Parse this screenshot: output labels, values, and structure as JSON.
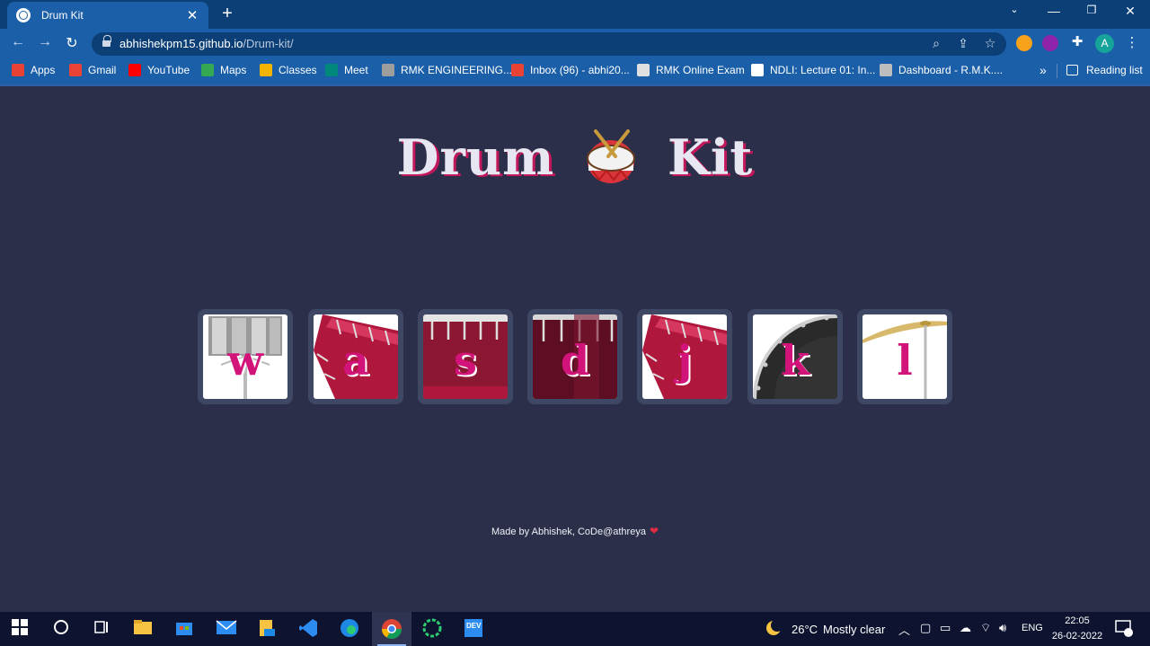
{
  "browser": {
    "tab_title": "Drum Kit",
    "url_host": "abhishekpm15.github.io",
    "url_path": "/Drum-kit/",
    "reading_list": "Reading list",
    "avatar_letter": "A",
    "bookmarks": [
      {
        "label": "Apps",
        "icon": "apps-grid-icon",
        "color": "#e94235"
      },
      {
        "label": "Gmail",
        "icon": "gmail-icon",
        "color": "#ea4335"
      },
      {
        "label": "YouTube",
        "icon": "youtube-icon",
        "color": "#ff0000"
      },
      {
        "label": "Maps",
        "icon": "maps-icon",
        "color": "#34a853"
      },
      {
        "label": "Classes",
        "icon": "classroom-icon",
        "color": "#f4b400"
      },
      {
        "label": "Meet",
        "icon": "meet-icon",
        "color": "#00897b"
      },
      {
        "label": "RMK ENGINEERING...",
        "icon": "college-logo-icon",
        "color": "#9e9e9e"
      },
      {
        "label": "Inbox (96) - abhi20...",
        "icon": "gmail-icon",
        "color": "#ea4335"
      },
      {
        "label": "RMK Online Exam",
        "icon": "exam-logo-icon",
        "color": "#e0e0e0"
      },
      {
        "label": "NDLI: Lecture 01: In...",
        "icon": "globe-icon",
        "color": "#ffffff"
      },
      {
        "label": "Dashboard - R.M.K....",
        "icon": "dashboard-icon",
        "color": "#bdbdbd"
      }
    ]
  },
  "page": {
    "title_left": "Drum",
    "title_right": "Kit",
    "drums": [
      {
        "key": "w",
        "kind": "tom-stand"
      },
      {
        "key": "a",
        "kind": "bass-tilted"
      },
      {
        "key": "s",
        "kind": "snare"
      },
      {
        "key": "d",
        "kind": "snare-dark"
      },
      {
        "key": "j",
        "kind": "bass-tilted"
      },
      {
        "key": "k",
        "kind": "kick"
      },
      {
        "key": "l",
        "kind": "cymbal"
      }
    ],
    "footer": "Made by Abhishek, CoDe@athreya"
  },
  "taskbar": {
    "weather_temp": "26°C",
    "weather_desc": "Mostly clear",
    "language": "ENG",
    "time": "22:05",
    "date": "26-02-2022",
    "notification_count": "1"
  },
  "colors": {
    "page_bg": "#2b2f4a",
    "letter": "#d1137a",
    "title_shadow": "#c2185b",
    "tile_border": "#3e4763"
  }
}
